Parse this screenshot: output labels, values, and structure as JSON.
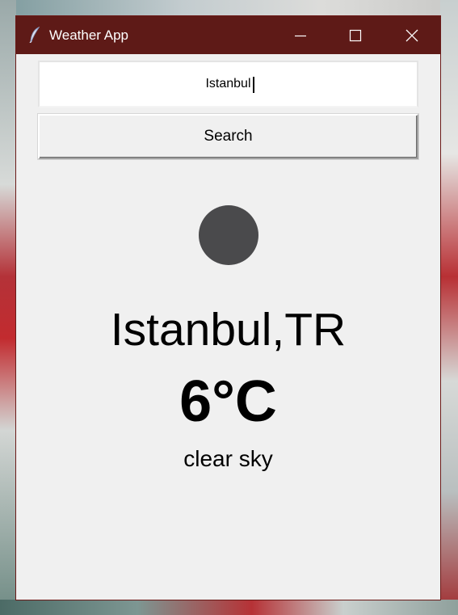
{
  "window": {
    "title": "Weather App",
    "titlebar_color": "#5e1a17",
    "body_color": "#f0f0f0",
    "icon": "feather-icon"
  },
  "search": {
    "value": "Istanbul",
    "button_label": "Search"
  },
  "weather": {
    "icon": "weather-condition-icon",
    "icon_color": "#4a4a4c",
    "location": "Istanbul,TR",
    "temperature": "6°C",
    "description": "clear sky"
  }
}
